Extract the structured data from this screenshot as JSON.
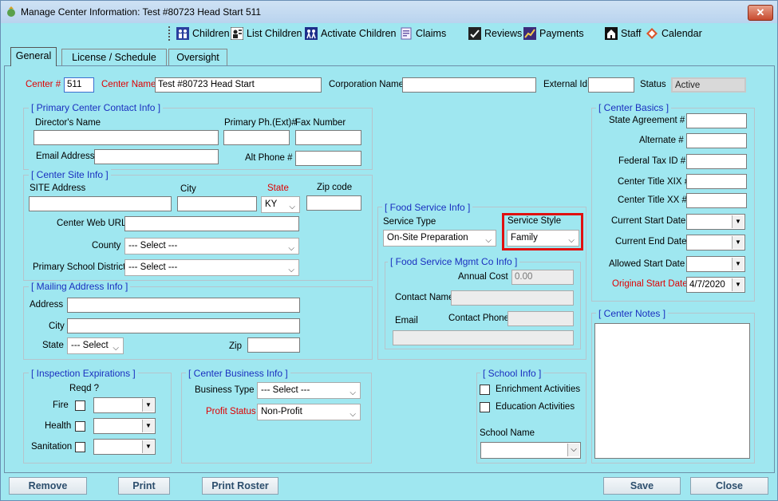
{
  "window": {
    "title": "Manage Center Information: Test #80723 Head Start   511",
    "close_glyph": "✕"
  },
  "toolbar": {
    "children": "Children",
    "list_children": "List Children",
    "activate_children": "Activate Children",
    "claims": "Claims",
    "reviews": "Reviews",
    "payments": "Payments",
    "staff": "Staff",
    "calendar": "Calendar"
  },
  "tabs": [
    "General",
    "License / Schedule",
    "Oversight"
  ],
  "header": {
    "center_no_label": "Center #",
    "center_no_value": "511",
    "center_name_label": "Center Name",
    "center_name_value": "Test #80723 Head Start",
    "corporation_label": "Corporation Name",
    "corporation_value": "",
    "external_id_label": "External Id",
    "external_id_value": "",
    "status_label": "Status",
    "status_value": "Active"
  },
  "primary_contact": {
    "title": "[ Primary Center Contact Info ]",
    "director_label": "Director's Name",
    "primary_ph_label": "Primary Ph.(Ext)#",
    "fax_label": "Fax Number",
    "email_label": "Email Address",
    "alt_phone_label": "Alt Phone #"
  },
  "site_info": {
    "title": "[ Center Site Info ]",
    "site_address_label": "SITE Address",
    "city_label": "City",
    "state_label": "State",
    "state_value": "KY",
    "zip_label": "Zip code",
    "web_url_label": "Center Web URL",
    "county_label": "County",
    "county_value": "--- Select ---",
    "school_district_label": "Primary School District",
    "school_district_value": "--- Select ---"
  },
  "mailing": {
    "title": "[ Mailing Address Info ]",
    "address_label": "Address",
    "city_label": "City",
    "state_label": "State",
    "state_value": "--- Select",
    "zip_label": "Zip"
  },
  "inspection": {
    "title": "[ Inspection Expirations ]",
    "reqd_label": "Reqd ?",
    "fire_label": "Fire",
    "health_label": "Health",
    "sanitation_label": "Sanitation"
  },
  "business": {
    "title": "[ Center Business Info ]",
    "type_label": "Business Type",
    "type_value": "--- Select ---",
    "profit_label": "Profit Status",
    "profit_value": "Non-Profit"
  },
  "food_service": {
    "title": "[ Food Service Info ]",
    "type_label": "Service Type",
    "type_value": "On-Site Preparation",
    "style_label": "Service Style",
    "style_value": "Family"
  },
  "food_mgmt": {
    "title": "[ Food Service Mgmt Co Info ]",
    "annual_cost_label": "Annual Cost",
    "annual_cost_value": "0.00",
    "contact_name_label": "Contact Name",
    "email_label": "Email",
    "contact_phone_label": "Contact Phone"
  },
  "school_info": {
    "title": "[ School Info ]",
    "enrichment_label": "Enrichment Activities",
    "education_label": "Education Activities",
    "school_name_label": "School Name"
  },
  "basics": {
    "title": "[ Center Basics ]",
    "state_agreement_label": "State Agreement #",
    "alternate_label": "Alternate #",
    "federal_tax_label": "Federal Tax ID #",
    "title_xix_label": "Center Title XIX #",
    "title_xx_label": "Center Title XX #",
    "current_start_label": "Current Start Date",
    "current_end_label": "Current End Date",
    "allowed_start_label": "Allowed Start Date",
    "original_start_label": "Original Start Date",
    "original_start_value": "4/7/2020"
  },
  "notes": {
    "title": "[ Center Notes ]"
  },
  "footer": {
    "remove": "Remove",
    "print": "Print",
    "print_roster": "Print Roster",
    "save": "Save",
    "close": "Close"
  },
  "icons": [
    "app-icon",
    "children-icon",
    "list-children-icon",
    "activate-children-icon",
    "claims-icon",
    "reviews-icon",
    "payments-icon",
    "staff-icon",
    "calendar-icon"
  ]
}
